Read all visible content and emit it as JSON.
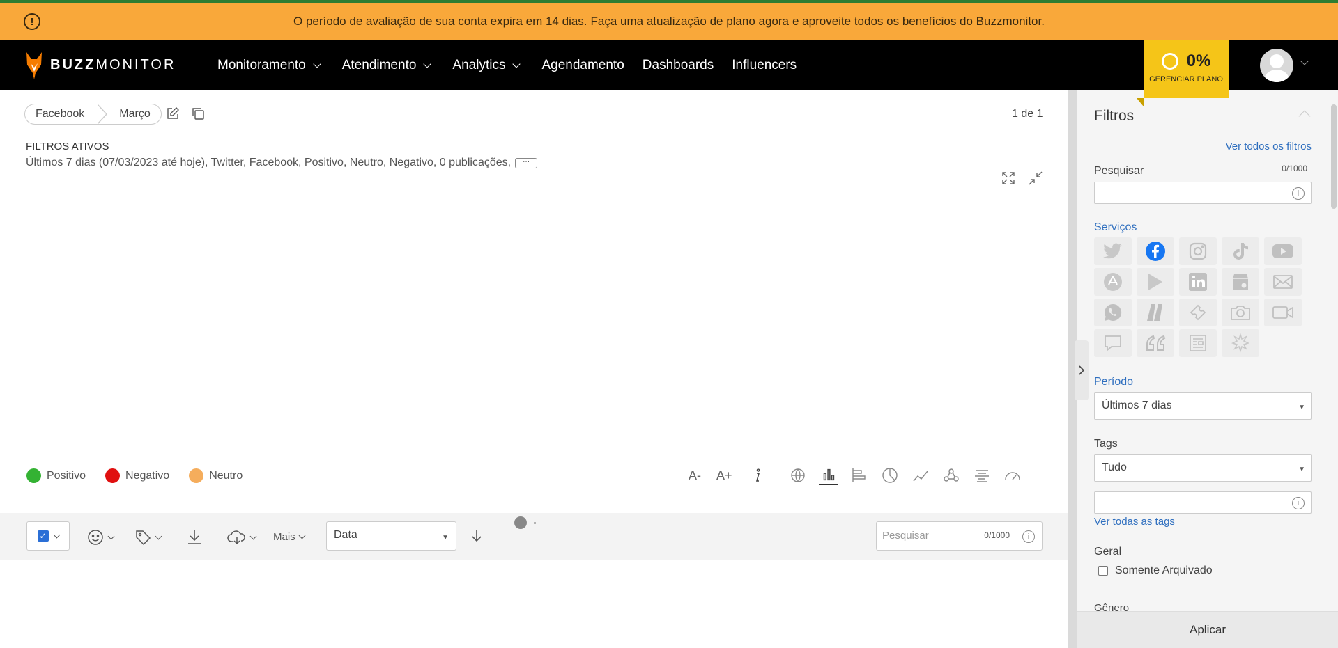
{
  "banner": {
    "text_before": "O período de avaliação de sua conta expira em 14 dias.",
    "link": "Faça uma atualização de plano agora",
    "text_after": "e aproveite todos os benefícios do Buzzmonitor."
  },
  "brand": {
    "part1": "BUZZ",
    "part2": "MONITOR"
  },
  "nav": {
    "items": [
      {
        "label": "Monitoramento",
        "dropdown": true
      },
      {
        "label": "Atendimento",
        "dropdown": true
      },
      {
        "label": "Analytics",
        "dropdown": true
      },
      {
        "label": "Agendamento",
        "dropdown": false
      },
      {
        "label": "Dashboards",
        "dropdown": false
      },
      {
        "label": "Influencers",
        "dropdown": false
      }
    ]
  },
  "plan": {
    "percent": "0%",
    "label": "GERENCIAR PLANO"
  },
  "breadcrumb": {
    "first": "Facebook",
    "second": "Março"
  },
  "pager": "1 de 1",
  "active_filters": {
    "title": "FILTROS ATIVOS",
    "summary": "Últimos 7 dias (07/03/2023 até hoje), Twitter, Facebook, Positivo, Neutro, Negativo, 0 publicações,",
    "more": "···"
  },
  "legend": [
    {
      "label": "Positivo",
      "color": "#34b233"
    },
    {
      "label": "Negativo",
      "color": "#e01010"
    },
    {
      "label": "Neutro",
      "color": "#f5ad5c"
    }
  ],
  "text_size": {
    "minus": "A-",
    "plus": "A+"
  },
  "actions": {
    "more_label": "Mais",
    "sort_select": "Data",
    "search_placeholder": "Pesquisar",
    "search_count": "0/1000"
  },
  "filters_panel": {
    "title": "Filtros",
    "see_all": "Ver todos os filtros",
    "search_label": "Pesquisar",
    "search_count": "0/1000",
    "services_label": "Serviços",
    "period_label": "Período",
    "period_value": "Últimos 7 dias",
    "tags_label": "Tags",
    "tags_value": "Tudo",
    "see_all_tags": "Ver todas as tags",
    "general_label": "Geral",
    "archived_label": "Somente Arquivado",
    "gender_label": "Gênero",
    "apply_label": "Aplicar"
  },
  "services": [
    {
      "icon": "twitter-icon",
      "active": false
    },
    {
      "icon": "facebook-icon",
      "active": true
    },
    {
      "icon": "instagram-icon",
      "active": false
    },
    {
      "icon": "tiktok-icon",
      "active": false
    },
    {
      "icon": "youtube-icon",
      "active": false
    },
    {
      "icon": "app-store-icon",
      "active": false
    },
    {
      "icon": "google-play-icon",
      "active": false
    },
    {
      "icon": "linkedin-icon",
      "active": false
    },
    {
      "icon": "google-business-icon",
      "active": false
    },
    {
      "icon": "email-icon",
      "active": false
    },
    {
      "icon": "whatsapp-icon",
      "active": false
    },
    {
      "icon": "reclame-aqui-icon",
      "active": false
    },
    {
      "icon": "ticket-icon",
      "active": false
    },
    {
      "icon": "camera-icon",
      "active": false
    },
    {
      "icon": "video-icon",
      "active": false
    },
    {
      "icon": "chat-icon",
      "active": false
    },
    {
      "icon": "quote-icon",
      "active": false
    },
    {
      "icon": "news-icon",
      "active": false
    },
    {
      "icon": "sparkle-icon",
      "active": false
    }
  ],
  "colors": {
    "banner": "#f9a83a",
    "plan": "#f5c518",
    "link": "#2f6fbf",
    "facebook": "#1877f2"
  }
}
